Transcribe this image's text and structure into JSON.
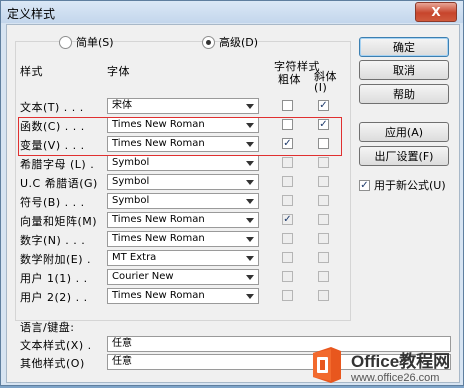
{
  "window": {
    "title": "定义样式",
    "close_label": "X"
  },
  "mode": {
    "simple_label": "简单(S)",
    "advanced_label": "高级(D)",
    "selected": "advanced"
  },
  "headers": {
    "style": "样式",
    "font": "字体",
    "char_style": "字符样式",
    "bold": "粗体",
    "italic": "斜体(I)"
  },
  "rows": [
    {
      "label": "文本(T)  . . .",
      "font": "宋体",
      "bold": false,
      "italic": true
    },
    {
      "label": "函数(C)  . . .",
      "font": "Times New Roman",
      "bold": false,
      "italic": true
    },
    {
      "label": "变量(V)  . . .",
      "font": "Times New Roman",
      "bold": true,
      "italic": false
    },
    {
      "label": "希腊字母 (L)  .",
      "font": "Symbol",
      "bold": false,
      "italic": false
    },
    {
      "label": "U.C 希腊语(G)",
      "font": "Symbol",
      "bold": false,
      "italic": false
    },
    {
      "label": "符号(B)  . . .",
      "font": "Symbol",
      "bold": false,
      "italic": false
    },
    {
      "label": "向量和矩阵(M)",
      "font": "Times New Roman",
      "bold": true,
      "italic": false
    },
    {
      "label": "数字(N)  . . .",
      "font": "Times New Roman",
      "bold": false,
      "italic": false
    },
    {
      "label": "数学附加(E)  .",
      "font": "MT Extra",
      "bold": false,
      "italic": false
    },
    {
      "label": "用户 1(1)  . .",
      "font": "Courier New",
      "bold": false,
      "italic": false
    },
    {
      "label": "用户 2(2)  . .",
      "font": "Times New Roman",
      "bold": false,
      "italic": false
    }
  ],
  "language": {
    "heading": "语言/键盘:",
    "text_style_label": "文本样式(X)  .",
    "text_style_value": "任意",
    "other_style_label": "其他样式(O)",
    "other_style_value": "任意"
  },
  "buttons": {
    "ok": "确定",
    "cancel": "取消",
    "help": "帮助",
    "apply": "应用(A)",
    "factory": "出厂设置(F)",
    "new_formula": "用于新公式(U)",
    "new_formula_checked": true
  },
  "watermark": {
    "title": "Office教程网",
    "url": "www.office26.com"
  },
  "colors": {
    "highlight_border": "#e03030",
    "logo_orange": "#e8571e"
  }
}
